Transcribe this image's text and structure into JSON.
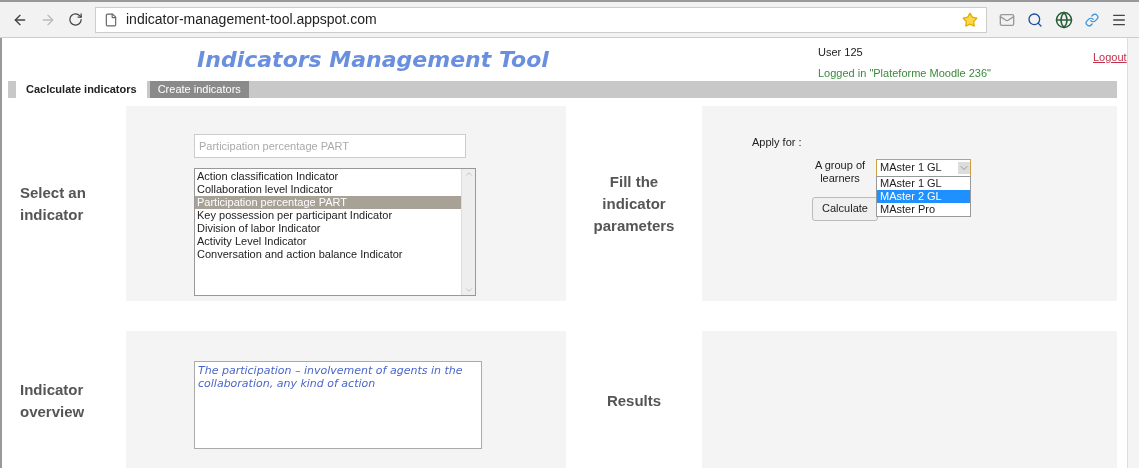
{
  "browser": {
    "url": "indicator-management-tool.appspot.com"
  },
  "header": {
    "title": "Indicators Management Tool",
    "user": "User 125",
    "logged_in": "Logged in \"Plateforme Moodle 236\"",
    "logout": "Logout"
  },
  "tabs": [
    {
      "label": "Caclculate indicators",
      "selected": true
    },
    {
      "label": "Create indicators",
      "selected": false
    }
  ],
  "select_section": {
    "label": "Select an indicator",
    "search": {
      "placeholder": "Participation percentage PART"
    },
    "indicators": [
      {
        "label": "Action classification Indicator",
        "selected": false
      },
      {
        "label": "Collaboration level Indicator",
        "selected": false
      },
      {
        "label": "Participation percentage PART",
        "selected": true
      },
      {
        "label": "Key possession per participant Indicator",
        "selected": false
      },
      {
        "label": "Division of labor Indicator",
        "selected": false
      },
      {
        "label": "Activity Level Indicator",
        "selected": false
      },
      {
        "label": "Conversation and action balance Indicator",
        "selected": false
      }
    ]
  },
  "parameters_section": {
    "label": "Fill the indicator parameters",
    "apply_for": "Apply for :",
    "group_label": "A group of learners",
    "group_value": "MAster 1 GL",
    "options": [
      {
        "label": "MAster 1 GL",
        "selected": false
      },
      {
        "label": "MAster 2 GL",
        "selected": true
      },
      {
        "label": "MAster Pro",
        "selected": false
      }
    ],
    "button": "Calculate"
  },
  "overview_section": {
    "label": "Indicator overview",
    "text": "The participation – involvement of agents in the collaboration, any kind of action"
  },
  "results_section": {
    "label": "Results"
  }
}
